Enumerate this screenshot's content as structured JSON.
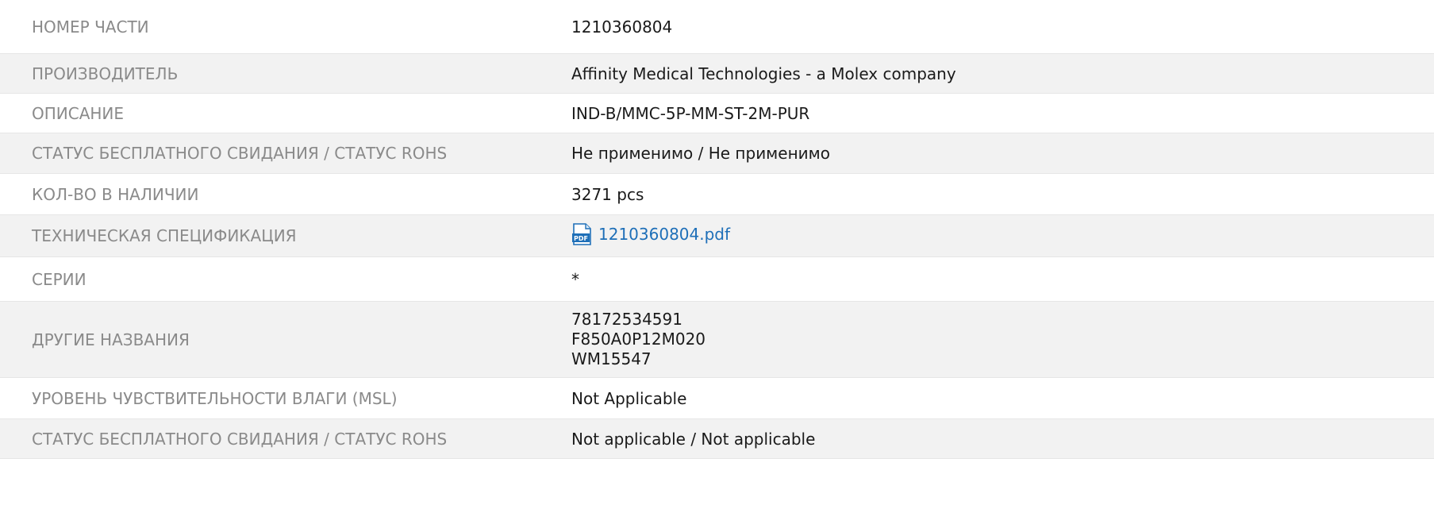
{
  "rows": [
    {
      "label": "НОМЕР ЧАСТИ",
      "value": "1210360804"
    },
    {
      "label": "ПРОИЗВОДИТЕЛЬ",
      "value": "Affinity Medical Technologies - a Molex company"
    },
    {
      "label": "ОПИСАНИЕ",
      "value": "IND-B/MMC-5P-MM-ST-2M-PUR"
    },
    {
      "label": "СТАТУС БЕСПЛАТНОГО СВИДАНИЯ / СТАТУС ROHS",
      "value": "Не применимо / Не применимо"
    },
    {
      "label": "КОЛ-ВО В НАЛИЧИИ",
      "value": "3271 pcs"
    },
    {
      "label": "ТЕХНИЧЕСКАЯ СПЕЦИФИКАЦИЯ",
      "value": "1210360804.pdf",
      "icon": "pdf-icon"
    },
    {
      "label": "СЕРИИ",
      "value": "*"
    },
    {
      "label": "ДРУГИЕ НАЗВАНИЯ",
      "values": [
        "78172534591",
        "F850A0P12M020",
        "WM15547"
      ]
    },
    {
      "label": "УРОВЕНЬ ЧУВСТВИТЕЛЬНОСТИ ВЛАГИ (MSL)",
      "value": "Not Applicable"
    },
    {
      "label": "СТАТУС БЕСПЛАТНОГО СВИДАНИЯ / СТАТУС ROHS",
      "value": "Not applicable / Not applicable"
    }
  ],
  "colors": {
    "label": "#8a8a8a",
    "value": "#1a1a1a",
    "link": "#1e6fb8",
    "row_alt": "#f2f2f2",
    "pdf_icon": "#1e6fb8"
  }
}
